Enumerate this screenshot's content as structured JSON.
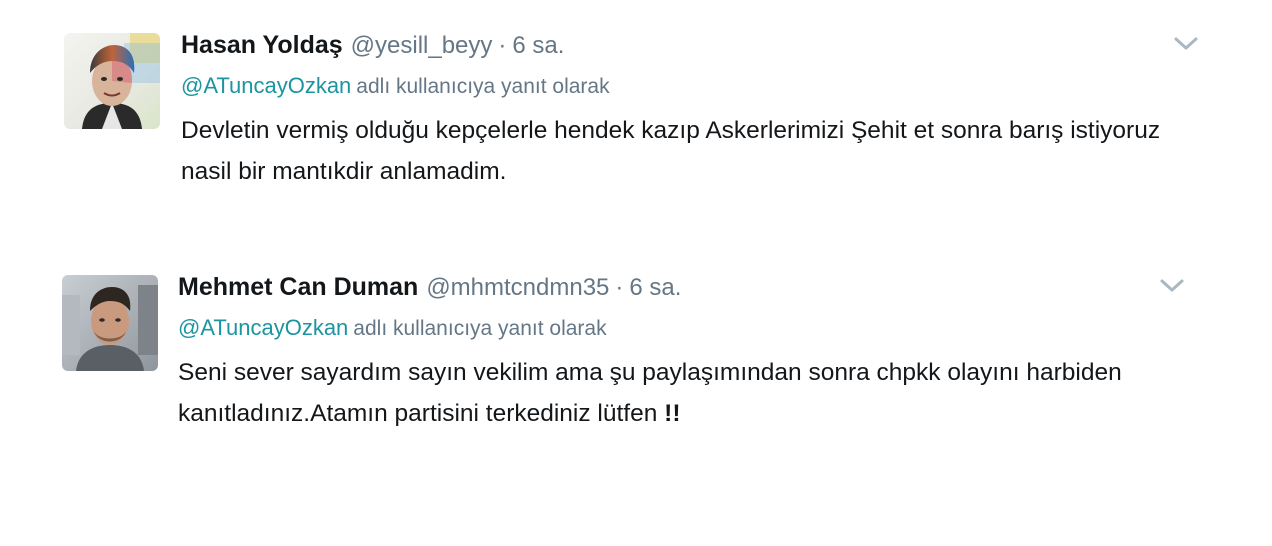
{
  "tweets": [
    {
      "fullname": "Hasan Yoldaş",
      "username": "@yesill_beyy",
      "separator": "·",
      "time": "6 sa.",
      "reply_mention": "@ATuncayOzkan",
      "reply_text": "adlı kullanıcıya yanıt olarak",
      "text": "Devletin vermiş olduğu kepçelerle hendek kazıp Askerlerimizi Şehit et sonra barış istiyoruz nasil bir mantıkdir anlamadim."
    },
    {
      "fullname": "Mehmet Can Duman",
      "username": "@mhmtcndmn35",
      "separator": "·",
      "time": "6 sa.",
      "reply_mention": "@ATuncayOzkan",
      "reply_text": "adlı kullanıcıya yanıt olarak",
      "text": "Seni sever sayardım sayın vekilim ama şu paylaşımından sonra chpkk olayını harbiden kanıtladınız.Atamın partisini terkediniz lütfen",
      "text_emphasis": "!!"
    }
  ],
  "colors": {
    "name": "#14171a",
    "meta": "#657786",
    "mention": "#1b95a0",
    "caret": "#aab8c2"
  },
  "icons": {
    "more": "chevron-down-icon",
    "avatar": "user-avatar"
  }
}
